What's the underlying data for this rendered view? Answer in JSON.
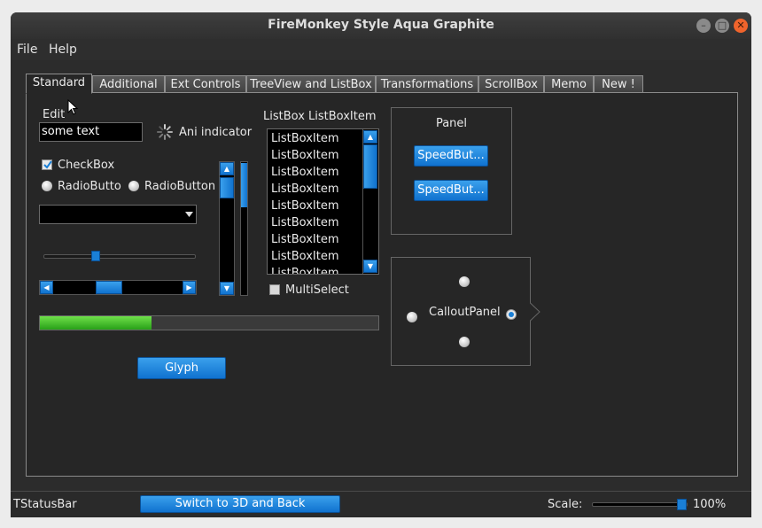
{
  "window": {
    "title": "FireMonkey Style Aqua Graphite"
  },
  "menu": [
    "File",
    "Help"
  ],
  "tabs": [
    "Standard",
    "Additional",
    "Ext Controls",
    "TreeView and ListBox",
    "Transformations",
    "ScrollBox",
    "Memo",
    "New !"
  ],
  "active_tab": "Standard",
  "standard": {
    "edit_label": "Edit",
    "edit_value": "some text",
    "ani_indicator_label": "Ani indicator",
    "checkbox_label": "CheckBox",
    "checkbox_checked": true,
    "radio1_label": "RadioButton",
    "radio2_label": "RadioButton",
    "listbox_label": "ListBox",
    "listboxitem_label": "ListBoxItem",
    "listbox_items": [
      "ListBoxItem",
      "ListBoxItem",
      "ListBoxItem",
      "ListBoxItem",
      "ListBoxItem",
      "ListBoxItem",
      "ListBoxItem",
      "ListBoxItem",
      "ListBoxItem"
    ],
    "multiselect_label": "MultiSelect",
    "panel_label": "Panel",
    "speedbutton1_label": "SpeedBut...",
    "speedbutton2_label": "SpeedBut...",
    "callout_label": "CalloutPanel",
    "glyph_label": "Glyph",
    "progress_fraction": 0.33,
    "trackbar_fraction": 0.34
  },
  "statusbar": {
    "label": "TStatusBar",
    "switch_label": "Switch to 3D and Back",
    "scale_label": "Scale:",
    "scale_value": "100%"
  },
  "colors": {
    "accent": "#1a7fd6",
    "progress": "#3fbf2a",
    "background": "#262626"
  }
}
